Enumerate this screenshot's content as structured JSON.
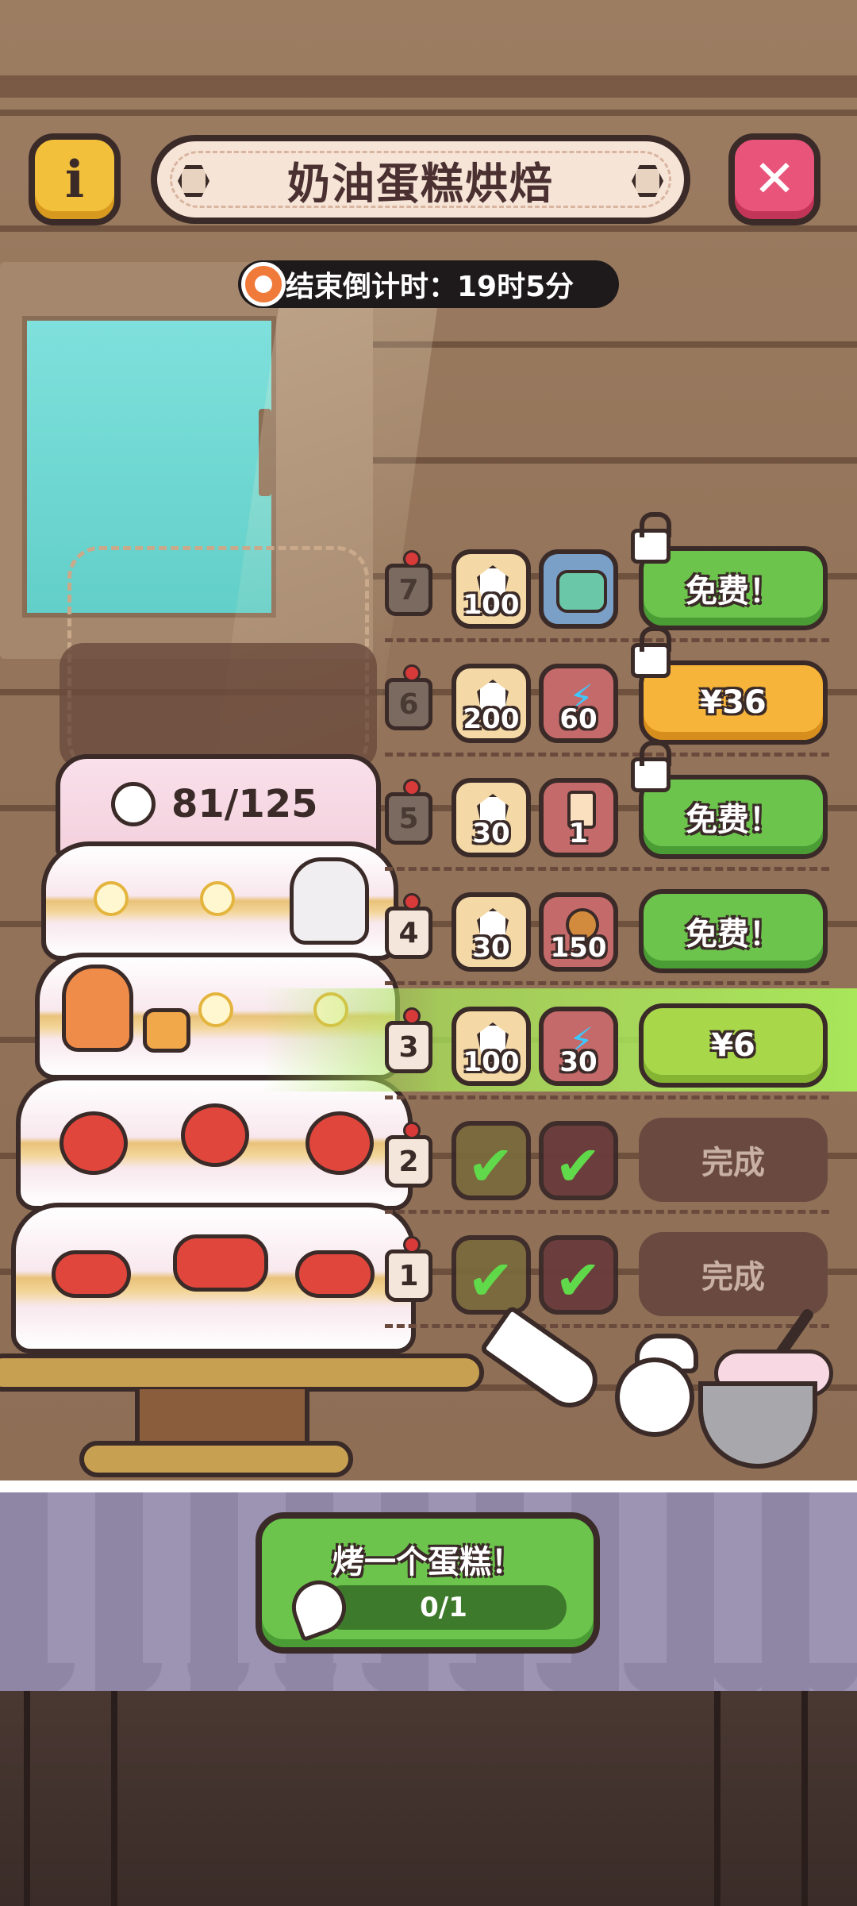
{
  "header": {
    "title": "奶油蛋糕烘焙",
    "info_icon_label": "i",
    "close_icon_label": "✕",
    "countdown": "结束倒计时：19时5分"
  },
  "cake": {
    "progress_text": "81/125",
    "progress_value": 81,
    "progress_max": 125
  },
  "reward_rows": [
    {
      "level": "7",
      "reward1_icon": "crystal-icon",
      "reward1_amount": "100",
      "reward2_icon": "robot-pack-icon",
      "reward2_amount": "",
      "button": "免费！",
      "button_style": "green",
      "locked": true
    },
    {
      "level": "6",
      "reward1_icon": "crystal-icon",
      "reward1_amount": "200",
      "reward2_icon": "lightning-icon",
      "reward2_amount": "60",
      "button": "¥36",
      "button_style": "orange",
      "locked": true
    },
    {
      "level": "5",
      "reward1_icon": "crystal-icon",
      "reward1_amount": "30",
      "reward2_icon": "card-pack-icon",
      "reward2_amount": "1",
      "button": "免费！",
      "button_style": "green",
      "locked": true
    },
    {
      "level": "4",
      "reward1_icon": "crystal-icon",
      "reward1_amount": "30",
      "reward2_icon": "cookie-icon",
      "reward2_amount": "150",
      "button": "免费！",
      "button_style": "green",
      "locked": false
    },
    {
      "level": "3",
      "reward1_icon": "crystal-icon",
      "reward1_amount": "100",
      "reward2_icon": "lightning-icon",
      "reward2_amount": "30",
      "button": "¥6",
      "button_style": "lime",
      "locked": false,
      "highlighted": true
    },
    {
      "level": "2",
      "reward1_icon": "check-icon",
      "reward1_amount": "",
      "reward2_icon": "check-icon",
      "reward2_amount": "",
      "button": "完成",
      "button_style": "done",
      "locked": false
    },
    {
      "level": "1",
      "reward1_icon": "check-icon",
      "reward1_amount": "",
      "reward2_icon": "check-icon",
      "reward2_amount": "",
      "button": "完成",
      "button_style": "done",
      "locked": false
    }
  ],
  "bake_button": {
    "label": "烤一个蛋糕！",
    "progress_text": "0/1"
  },
  "colors": {
    "green_button": "#6cc44c",
    "orange_button": "#f6b43a",
    "close_button": "#e8547a",
    "info_button": "#f3c03c",
    "highlight": "#a8e65a"
  }
}
